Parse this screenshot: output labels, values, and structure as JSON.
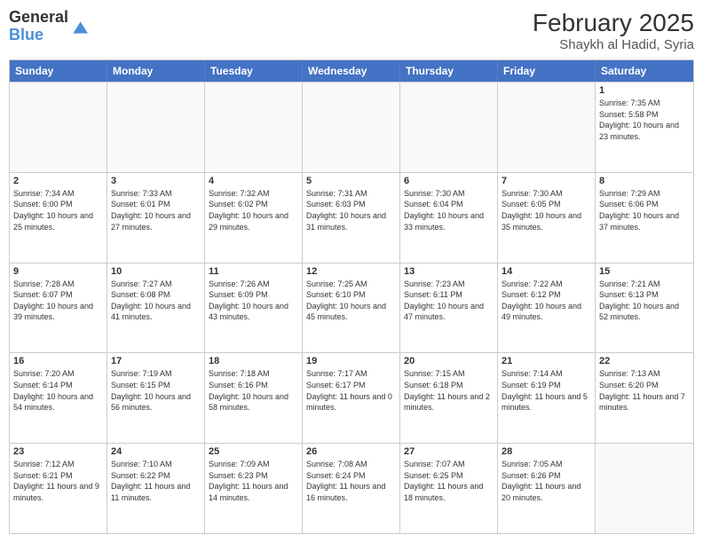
{
  "logo": {
    "general": "General",
    "blue": "Blue"
  },
  "title": {
    "month_year": "February 2025",
    "location": "Shaykh al Hadid, Syria"
  },
  "day_headers": [
    "Sunday",
    "Monday",
    "Tuesday",
    "Wednesday",
    "Thursday",
    "Friday",
    "Saturday"
  ],
  "weeks": [
    [
      {
        "num": "",
        "info": ""
      },
      {
        "num": "",
        "info": ""
      },
      {
        "num": "",
        "info": ""
      },
      {
        "num": "",
        "info": ""
      },
      {
        "num": "",
        "info": ""
      },
      {
        "num": "",
        "info": ""
      },
      {
        "num": "1",
        "info": "Sunrise: 7:35 AM\nSunset: 5:58 PM\nDaylight: 10 hours and 23 minutes."
      }
    ],
    [
      {
        "num": "2",
        "info": "Sunrise: 7:34 AM\nSunset: 6:00 PM\nDaylight: 10 hours and 25 minutes."
      },
      {
        "num": "3",
        "info": "Sunrise: 7:33 AM\nSunset: 6:01 PM\nDaylight: 10 hours and 27 minutes."
      },
      {
        "num": "4",
        "info": "Sunrise: 7:32 AM\nSunset: 6:02 PM\nDaylight: 10 hours and 29 minutes."
      },
      {
        "num": "5",
        "info": "Sunrise: 7:31 AM\nSunset: 6:03 PM\nDaylight: 10 hours and 31 minutes."
      },
      {
        "num": "6",
        "info": "Sunrise: 7:30 AM\nSunset: 6:04 PM\nDaylight: 10 hours and 33 minutes."
      },
      {
        "num": "7",
        "info": "Sunrise: 7:30 AM\nSunset: 6:05 PM\nDaylight: 10 hours and 35 minutes."
      },
      {
        "num": "8",
        "info": "Sunrise: 7:29 AM\nSunset: 6:06 PM\nDaylight: 10 hours and 37 minutes."
      }
    ],
    [
      {
        "num": "9",
        "info": "Sunrise: 7:28 AM\nSunset: 6:07 PM\nDaylight: 10 hours and 39 minutes."
      },
      {
        "num": "10",
        "info": "Sunrise: 7:27 AM\nSunset: 6:08 PM\nDaylight: 10 hours and 41 minutes."
      },
      {
        "num": "11",
        "info": "Sunrise: 7:26 AM\nSunset: 6:09 PM\nDaylight: 10 hours and 43 minutes."
      },
      {
        "num": "12",
        "info": "Sunrise: 7:25 AM\nSunset: 6:10 PM\nDaylight: 10 hours and 45 minutes."
      },
      {
        "num": "13",
        "info": "Sunrise: 7:23 AM\nSunset: 6:11 PM\nDaylight: 10 hours and 47 minutes."
      },
      {
        "num": "14",
        "info": "Sunrise: 7:22 AM\nSunset: 6:12 PM\nDaylight: 10 hours and 49 minutes."
      },
      {
        "num": "15",
        "info": "Sunrise: 7:21 AM\nSunset: 6:13 PM\nDaylight: 10 hours and 52 minutes."
      }
    ],
    [
      {
        "num": "16",
        "info": "Sunrise: 7:20 AM\nSunset: 6:14 PM\nDaylight: 10 hours and 54 minutes."
      },
      {
        "num": "17",
        "info": "Sunrise: 7:19 AM\nSunset: 6:15 PM\nDaylight: 10 hours and 56 minutes."
      },
      {
        "num": "18",
        "info": "Sunrise: 7:18 AM\nSunset: 6:16 PM\nDaylight: 10 hours and 58 minutes."
      },
      {
        "num": "19",
        "info": "Sunrise: 7:17 AM\nSunset: 6:17 PM\nDaylight: 11 hours and 0 minutes."
      },
      {
        "num": "20",
        "info": "Sunrise: 7:15 AM\nSunset: 6:18 PM\nDaylight: 11 hours and 2 minutes."
      },
      {
        "num": "21",
        "info": "Sunrise: 7:14 AM\nSunset: 6:19 PM\nDaylight: 11 hours and 5 minutes."
      },
      {
        "num": "22",
        "info": "Sunrise: 7:13 AM\nSunset: 6:20 PM\nDaylight: 11 hours and 7 minutes."
      }
    ],
    [
      {
        "num": "23",
        "info": "Sunrise: 7:12 AM\nSunset: 6:21 PM\nDaylight: 11 hours and 9 minutes."
      },
      {
        "num": "24",
        "info": "Sunrise: 7:10 AM\nSunset: 6:22 PM\nDaylight: 11 hours and 11 minutes."
      },
      {
        "num": "25",
        "info": "Sunrise: 7:09 AM\nSunset: 6:23 PM\nDaylight: 11 hours and 14 minutes."
      },
      {
        "num": "26",
        "info": "Sunrise: 7:08 AM\nSunset: 6:24 PM\nDaylight: 11 hours and 16 minutes."
      },
      {
        "num": "27",
        "info": "Sunrise: 7:07 AM\nSunset: 6:25 PM\nDaylight: 11 hours and 18 minutes."
      },
      {
        "num": "28",
        "info": "Sunrise: 7:05 AM\nSunset: 6:26 PM\nDaylight: 11 hours and 20 minutes."
      },
      {
        "num": "",
        "info": ""
      }
    ]
  ]
}
